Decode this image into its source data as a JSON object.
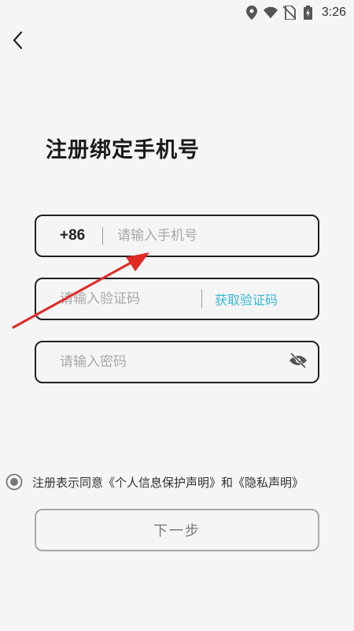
{
  "status_bar": {
    "time": "3:26",
    "icons": [
      "location-icon",
      "wifi-icon",
      "no-sim-icon",
      "battery-charging-icon"
    ]
  },
  "header": {
    "back_icon": "chevron-left-icon"
  },
  "page": {
    "title": "注册绑定手机号"
  },
  "phone": {
    "country_code": "+86",
    "value": "",
    "placeholder": "请输入手机号"
  },
  "code": {
    "value": "",
    "placeholder": "请输入验证码",
    "get_code_label": "获取验证码"
  },
  "password": {
    "value": "",
    "placeholder": "请输入密码",
    "toggle_icon": "eye-off-icon"
  },
  "agreement": {
    "text": "注册表示同意《个人信息保护声明》和《隐私声明》"
  },
  "next": {
    "label": "下一步"
  },
  "colors": {
    "accent": "#37b7d3",
    "annotation": "#e02a26",
    "border": "#222222",
    "disabled": "#a8a8a8"
  }
}
